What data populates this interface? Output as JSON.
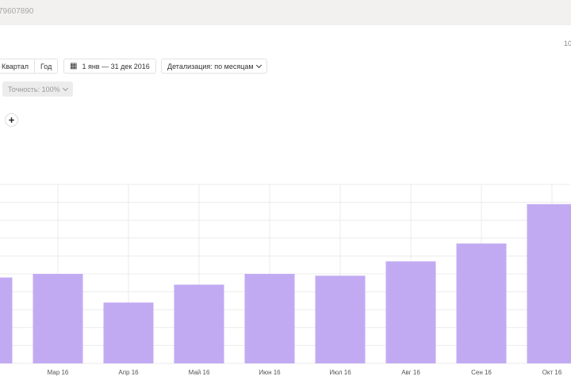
{
  "header": {
    "counter_id": "79607890",
    "corner_text": "10"
  },
  "toolbar": {
    "period_segments": [
      "Квартал",
      "Год"
    ],
    "date_range": "1 янв — 31 дек 2016",
    "detail": "Детализация: по месяцам",
    "accuracy": "Точность: 100%",
    "add_button": "+"
  },
  "colors": {
    "bar": "#c2aaf3",
    "grid": "#ebebeb",
    "topbar": "#f2f1ef"
  },
  "chart_data": {
    "type": "bar",
    "title": "",
    "xlabel": "",
    "ylabel": "",
    "categories": [
      "",
      "Мар 16",
      "Апр 16",
      "Май 16",
      "Июн 16",
      "Июл 16",
      "Авг 16",
      "Сен 16",
      "Окт 16"
    ],
    "values": [
      4.8,
      5.0,
      3.4,
      4.4,
      5.0,
      4.9,
      5.7,
      6.7,
      8.9
    ],
    "ylim": [
      0,
      10
    ],
    "grid": true
  }
}
